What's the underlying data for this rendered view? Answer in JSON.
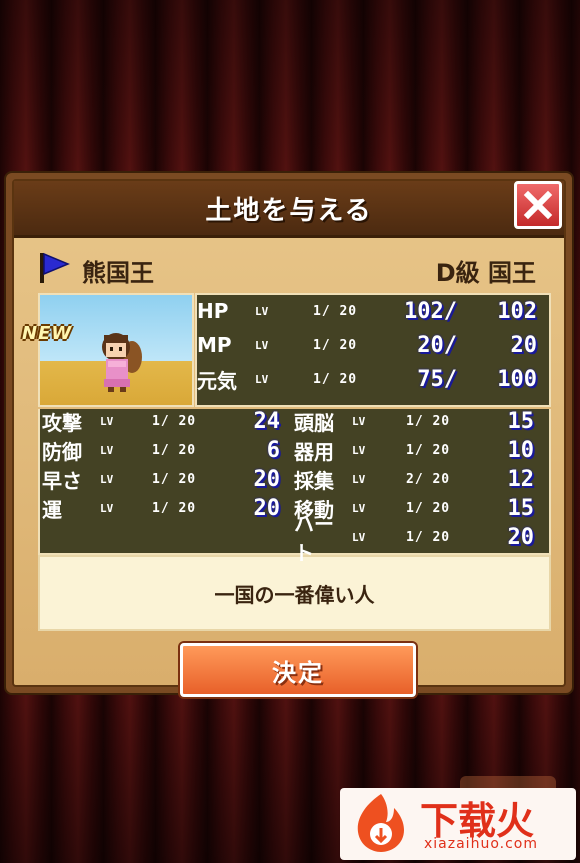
{
  "dialog": {
    "title": "土地を与える",
    "character": {
      "name": "熊国王",
      "rank": "D級 国王",
      "badge": "NEW",
      "description": "一国の一番偉い人"
    },
    "vitals": [
      {
        "label": "HP",
        "lv": "LV",
        "level": "1/ 20",
        "current": "102/",
        "max": "102"
      },
      {
        "label": "MP",
        "lv": "LV",
        "level": "1/ 20",
        "current": "20/",
        "max": "20"
      },
      {
        "label": "元気",
        "lv": "LV",
        "level": "1/ 20",
        "current": "75/",
        "max": "100"
      }
    ],
    "stats_left": [
      {
        "label": "攻撃",
        "lv": "LV",
        "level": "1/ 20",
        "value": "24"
      },
      {
        "label": "防御",
        "lv": "LV",
        "level": "1/ 20",
        "value": "6"
      },
      {
        "label": "早さ",
        "lv": "LV",
        "level": "1/ 20",
        "value": "20"
      },
      {
        "label": "運",
        "lv": "LV",
        "level": "1/ 20",
        "value": "20"
      }
    ],
    "stats_right": [
      {
        "label": "頭脳",
        "lv": "LV",
        "level": "1/ 20",
        "value": "15"
      },
      {
        "label": "器用",
        "lv": "LV",
        "level": "1/ 20",
        "value": "10"
      },
      {
        "label": "採集",
        "lv": "LV",
        "level": "2/ 20",
        "value": "12"
      },
      {
        "label": "移動",
        "lv": "LV",
        "level": "1/ 20",
        "value": "15"
      },
      {
        "label": "ハート",
        "lv": "LV",
        "level": "1/ 20",
        "value": "20"
      }
    ],
    "confirm_label": "決定"
  },
  "watermark": {
    "text": "下载火",
    "url": "xiazaihuo.com"
  },
  "colors": {
    "frame": "#7a4a22",
    "panel": "#444224",
    "confirm": "#e8602a",
    "close": "#c42a2a"
  },
  "icons": [
    "flag-icon",
    "close-icon",
    "character-sprite",
    "watermark-logo-icon"
  ]
}
